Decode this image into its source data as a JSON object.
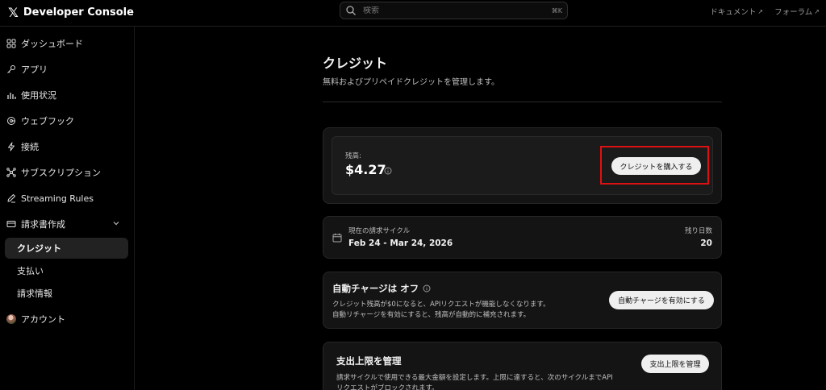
{
  "header": {
    "logo_glyph": "𝕏",
    "title": "Developer Console",
    "search_placeholder": "検索",
    "search_shortcut": "⌘K",
    "links": [
      {
        "label": "ドキュメント",
        "ext": "↗"
      },
      {
        "label": "フォーラム",
        "ext": "↗"
      }
    ]
  },
  "sidebar": {
    "items": [
      {
        "label": "ダッシュボード",
        "icon": "dashboard-icon"
      },
      {
        "label": "アプリ",
        "icon": "key-icon"
      },
      {
        "label": "使用状況",
        "icon": "bar-chart-icon"
      },
      {
        "label": "ウェブフック",
        "icon": "webhook-icon"
      },
      {
        "label": "接続",
        "icon": "lightning-icon"
      },
      {
        "label": "サブスクリプション",
        "icon": "subscription-icon"
      },
      {
        "label": "Streaming Rules",
        "icon": "pencil-icon"
      },
      {
        "label": "請求書作成",
        "icon": "billing-icon"
      },
      {
        "label": "クレジット",
        "icon": ""
      },
      {
        "label": "支払い",
        "icon": ""
      },
      {
        "label": "請求情報",
        "icon": ""
      },
      {
        "label": "アカウント",
        "icon": "avatar"
      }
    ]
  },
  "main": {
    "title": "クレジット",
    "subtitle": "無料およびプリペイドクレジットを管理します。",
    "balance": {
      "label": "残高:",
      "value": "$4.27",
      "buy_button": "クレジットを購入する"
    },
    "cycle": {
      "label": "現在の請求サイクル",
      "value": "Feb 24 - Mar 24, 2026",
      "days_label": "残り日数",
      "days_value": "20"
    },
    "auto_charge": {
      "title": "自動チャージは オフ",
      "desc1": "クレジット残高が$0になると、APIリクエストが機能しなくなります。",
      "desc2": "自動リチャージを有効にすると、残高が自動的に補充されます。",
      "button": "自動チャージを有効にする"
    },
    "spend_limit": {
      "title": "支出上限を管理",
      "desc1": "請求サイクルで使用できる最大金額を設定します。上限に達すると、次のサイクルまでAPI",
      "desc2": "リクエストがブロックされます。",
      "button": "支出上限を管理"
    }
  },
  "colors": {
    "background": "#000000",
    "card": "#141414",
    "button": "#efefef",
    "highlight": "#dd1111"
  }
}
